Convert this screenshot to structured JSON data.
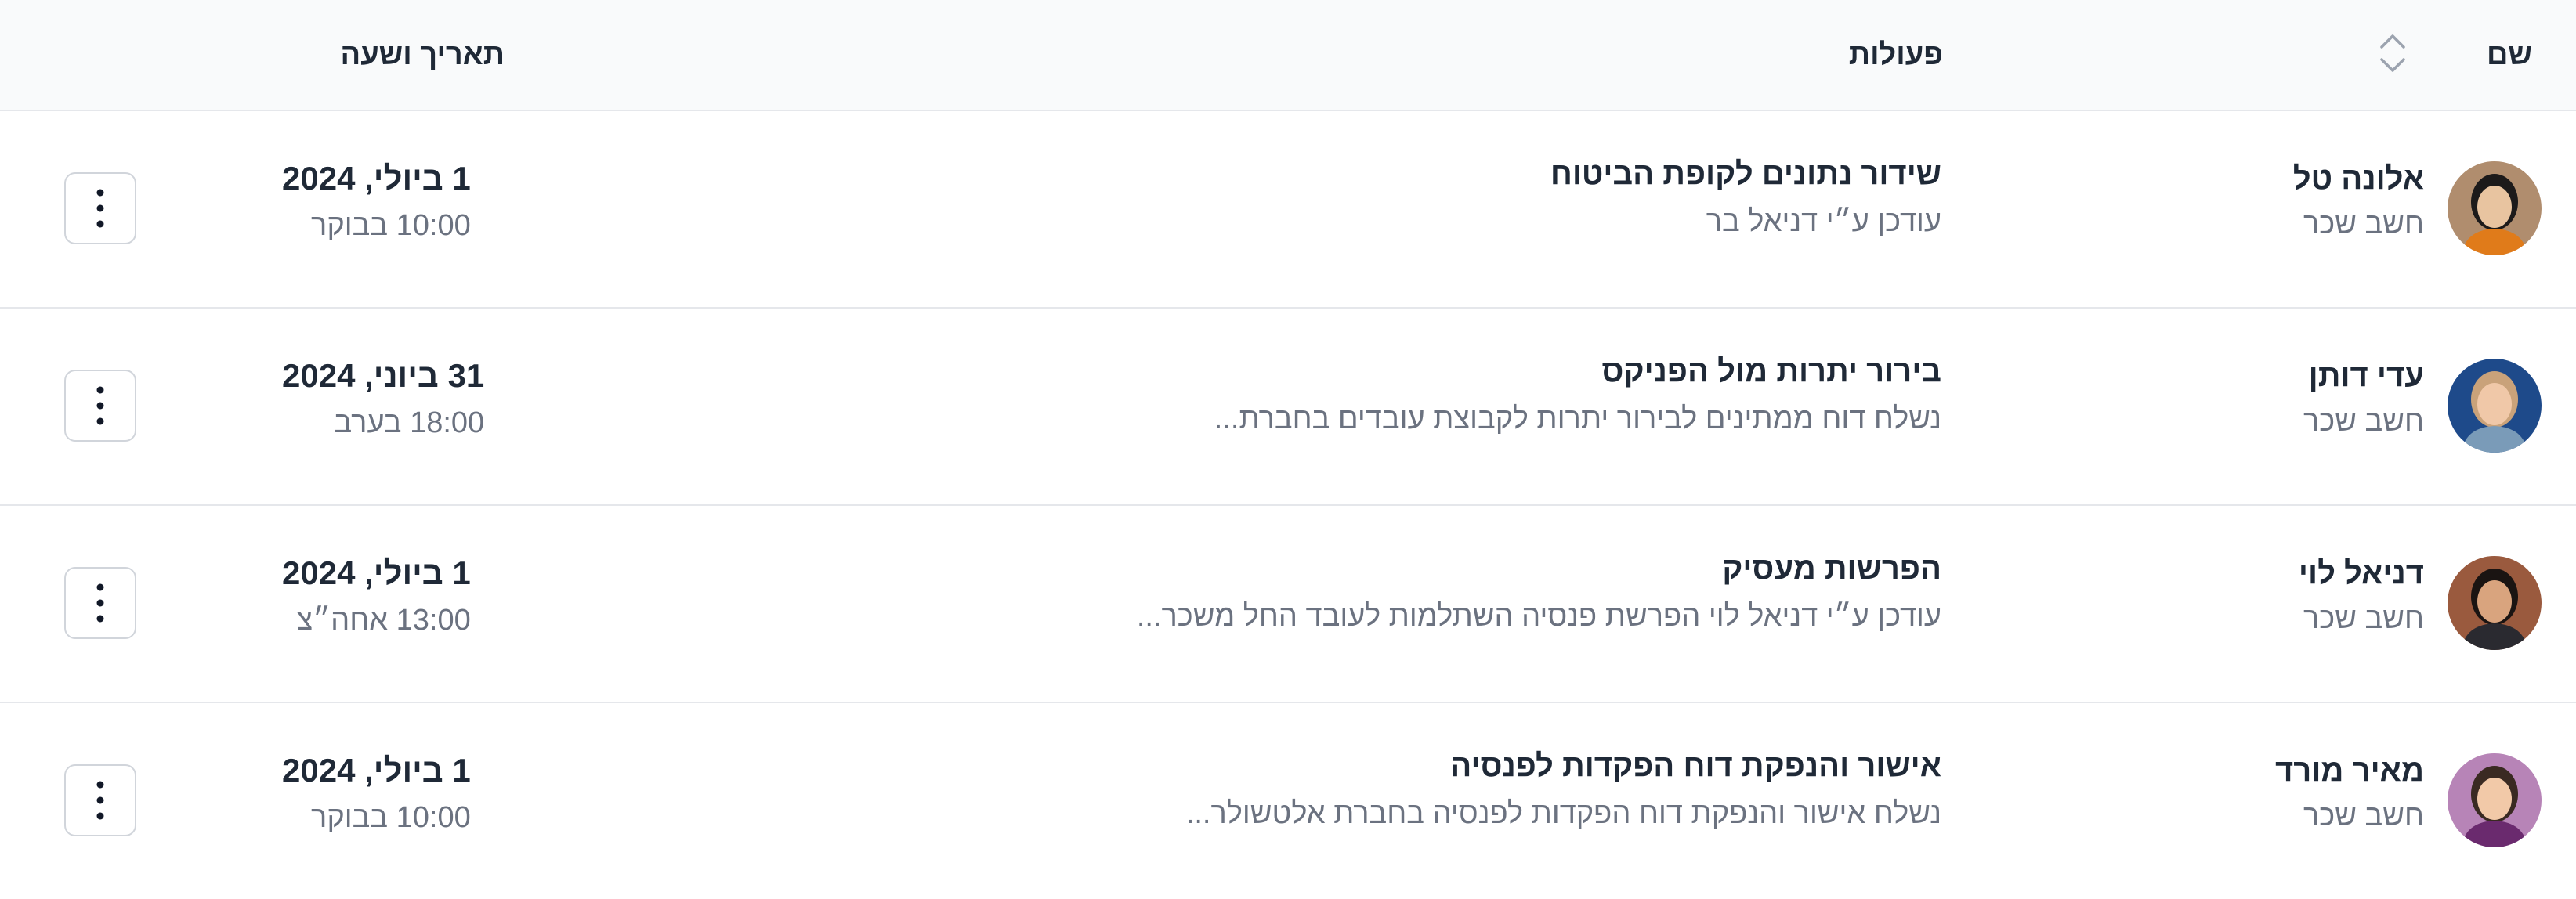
{
  "header": {
    "name": "שם",
    "actions": "פעולות",
    "datetime": "תאריך ושעה",
    "sort_icon": "sort-icon"
  },
  "rows": [
    {
      "name": "אלונה טל",
      "role": "חשב שכר",
      "action_title": "שידור נתונים לקופת הביטוח",
      "action_desc": "עודכן ע״י דניאל בר",
      "date": "1 ביולי, 2024",
      "time": "10:00 בבוקר",
      "avatar_colors": {
        "bg": "#b08d6e",
        "face": "#e8c4a0",
        "hair": "#1c1a1a",
        "shirt": "#e07b1a"
      }
    },
    {
      "name": "עדי דותן",
      "role": "חשב שכר",
      "action_title": "בירור יתרות מול הפניקס",
      "action_desc": "נשלח דוח ממתינים לבירור יתרות לקבוצת עובדים בחברת...",
      "date": "31 ביוני, 2024",
      "time": "18:00 בערב",
      "avatar_colors": {
        "bg": "#1e4a8a",
        "face": "#f0c8a8",
        "hair": "#c9a27a",
        "shirt": "#7a9bb8"
      }
    },
    {
      "name": "דניאל לוי",
      "role": "חשב שכר",
      "action_title": "הפרשות מעסיק",
      "action_desc": "עודכן ע״י דניאל לוי הפרשת פנסיה השתלמות לעובד החל משכר...",
      "date": "1 ביולי, 2024",
      "time": "13:00 אחה״צ",
      "avatar_colors": {
        "bg": "#9a5a3e",
        "face": "#d9a47e",
        "hair": "#1a1412",
        "shirt": "#2a2a30"
      }
    },
    {
      "name": "מאיר מורד",
      "role": "חשב שכר",
      "action_title": "אישור והנפקת דוח הפקדות לפנסיה",
      "action_desc": "נשלח אישור והנפקת דוח הפקדות לפנסיה בחברת אלטשולר...",
      "date": "1 ביולי, 2024",
      "time": "10:00 בבוקר",
      "avatar_colors": {
        "bg": "#b784b7",
        "face": "#f2c9a8",
        "hair": "#3a2a22",
        "shirt": "#6a2a6e"
      }
    }
  ],
  "icons": {
    "menu": "more-vertical-icon"
  }
}
